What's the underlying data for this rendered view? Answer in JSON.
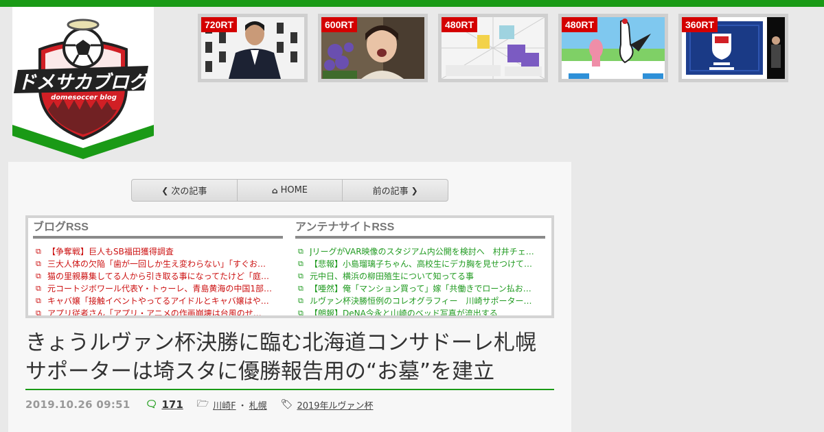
{
  "site": {
    "logo_text": "ドメサカブログ",
    "logo_sub": "domesoccer blog",
    "accent": "#1a9a16",
    "logo_red": "#d11f25"
  },
  "ranking": [
    {
      "rt": "720RT",
      "alt": "press-conference"
    },
    {
      "rt": "600RT",
      "alt": "child-drama"
    },
    {
      "rt": "480RT",
      "alt": "uniform-illustration"
    },
    {
      "rt": "480RT",
      "alt": "mascot-cartoon"
    },
    {
      "rt": "360RT",
      "alt": "fc-machida-tokyo"
    }
  ],
  "nav": {
    "prev": "次の記事",
    "home": "HOME",
    "next": "前の記事"
  },
  "rss": {
    "blog": {
      "title": "ブログRSS",
      "items": [
        "【争奪戦】巨人もSB福田獲得調査",
        "三大人体の欠陥「歯が一回しか生え変わらない」「すぐお…",
        "猫の里親募集してる人から引き取る事になってたけど「庭…",
        "元コートジボワール代表Y・トゥーレ、青島黄海の中国1部…",
        "キャバ嬢「接触イベントやってるアイドルとキャバ嬢はや…",
        "アプリ従者さん「アプリ・アニメの作画崩壊は台風のせ…"
      ]
    },
    "antenna": {
      "title": "アンテナサイトRSS",
      "items": [
        "JリーグがVAR映像のスタジアム内公開を検討へ　村井チェ…",
        "【悲報】小島瑠璃子ちゃん、高校生にデカ胸を見せつけて…",
        "元中日、横浜の柳田殖生について知ってる事",
        "【唖然】俺「マンション買って」嫁「共働きでローン払お…",
        "ルヴァン杯決勝恒例のコレオグラフィー　川崎サポーター…",
        "【朗報】DeNA今永と山崎のベッド写真が流出する"
      ]
    }
  },
  "article": {
    "title": "きょうルヴァン杯決勝に臨む北海道コンサドーレ札幌　サポーターは埼スタに優勝報告用の“お墓”を建立",
    "date": "2019.10.26 09:51",
    "comments": "171",
    "category_1": "川崎F",
    "category_sep": "・",
    "category_2": "札幌",
    "tag": "2019年ルヴァン杯"
  }
}
